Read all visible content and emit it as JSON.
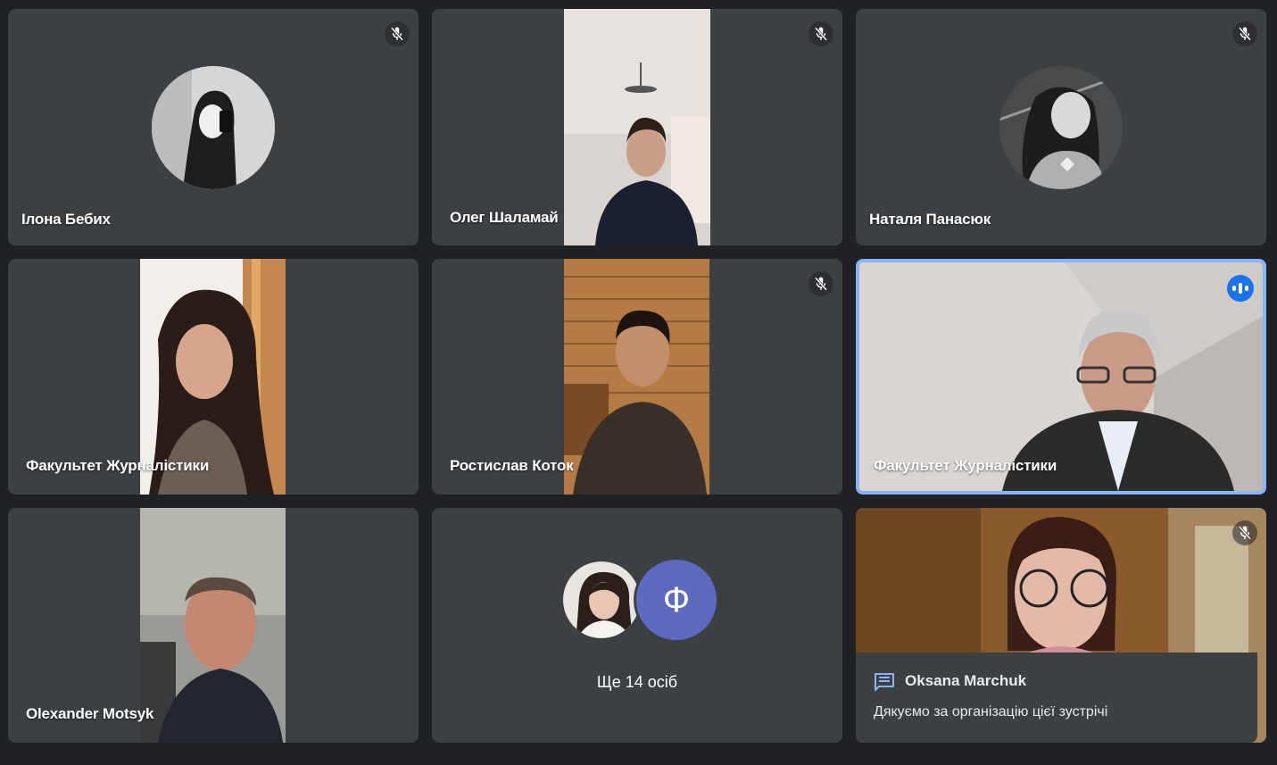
{
  "participants": [
    {
      "name": "Ілона Бебих",
      "muted": true
    },
    {
      "name": "Олег Шаламай",
      "muted": true
    },
    {
      "name": "Наталя Панасюк",
      "muted": true
    },
    {
      "name": "Факультет Журналістики",
      "muted": false
    },
    {
      "name": "Ростислав Коток",
      "muted": true
    },
    {
      "name": "Факультет Журналістики",
      "muted": false,
      "speaking": true
    },
    {
      "name": "Olexander Motsyk",
      "muted": false
    },
    {
      "name": "Oksana Marchuk",
      "muted": true
    }
  ],
  "others": {
    "avatar_letter": "Ф",
    "label": "Ще 14 осіб",
    "avatar_color": "#5c6bc0"
  },
  "chat_toast": {
    "sender": "Oksana Marchuk",
    "message": "Дякуємо за організацію цієї зустрічі"
  },
  "colors": {
    "background": "#202124",
    "tile": "#3c4043",
    "active_border": "#8ab4f8",
    "speaking": "#1a73e8"
  },
  "icons": [
    "mic-off-icon",
    "speaking-indicator-icon",
    "chat-icon"
  ]
}
